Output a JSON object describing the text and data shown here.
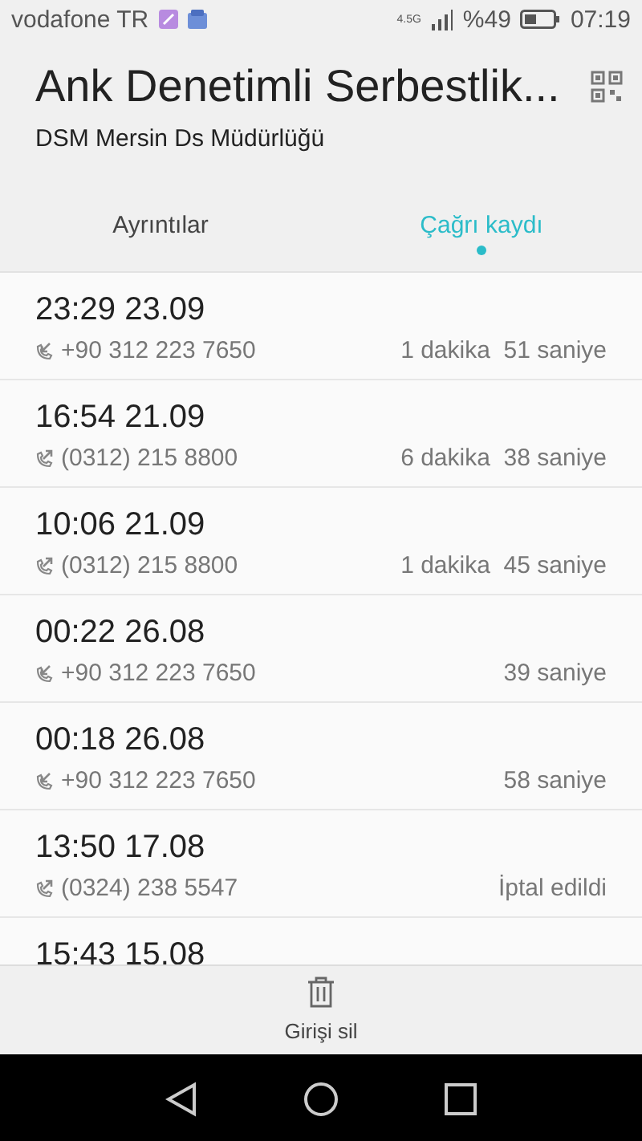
{
  "status_bar": {
    "carrier": "vodafone TR",
    "network": "4.5G",
    "battery": "%49",
    "time": "07:19"
  },
  "header": {
    "title": "Ank Denetimli Serbestlik...",
    "subtitle": "DSM Mersin Ds Müdürlüğü"
  },
  "tabs": [
    {
      "label": "Ayrıntılar",
      "selected": false
    },
    {
      "label": "Çağrı kaydı",
      "selected": true
    }
  ],
  "calls": [
    {
      "datetime": "23:29 23.09",
      "kind": "incoming",
      "number": "+90 312 223 7650",
      "duration": "1 dakika  51 saniye"
    },
    {
      "datetime": "16:54 21.09",
      "kind": "outgoing",
      "number": "(0312) 215 8800",
      "duration": "6 dakika  38 saniye"
    },
    {
      "datetime": "10:06 21.09",
      "kind": "outgoing",
      "number": "(0312) 215 8800",
      "duration": "1 dakika  45 saniye"
    },
    {
      "datetime": "00:22 26.08",
      "kind": "incoming",
      "number": "+90 312 223 7650",
      "duration": "39 saniye"
    },
    {
      "datetime": "00:18 26.08",
      "kind": "incoming",
      "number": "+90 312 223 7650",
      "duration": "58 saniye"
    },
    {
      "datetime": "13:50 17.08",
      "kind": "outgoing",
      "number": "(0324) 238 5547",
      "duration": "İptal edildi"
    },
    {
      "datetime": "15:43 15.08"
    }
  ],
  "bottom_action": {
    "label": "Girişi sil"
  }
}
